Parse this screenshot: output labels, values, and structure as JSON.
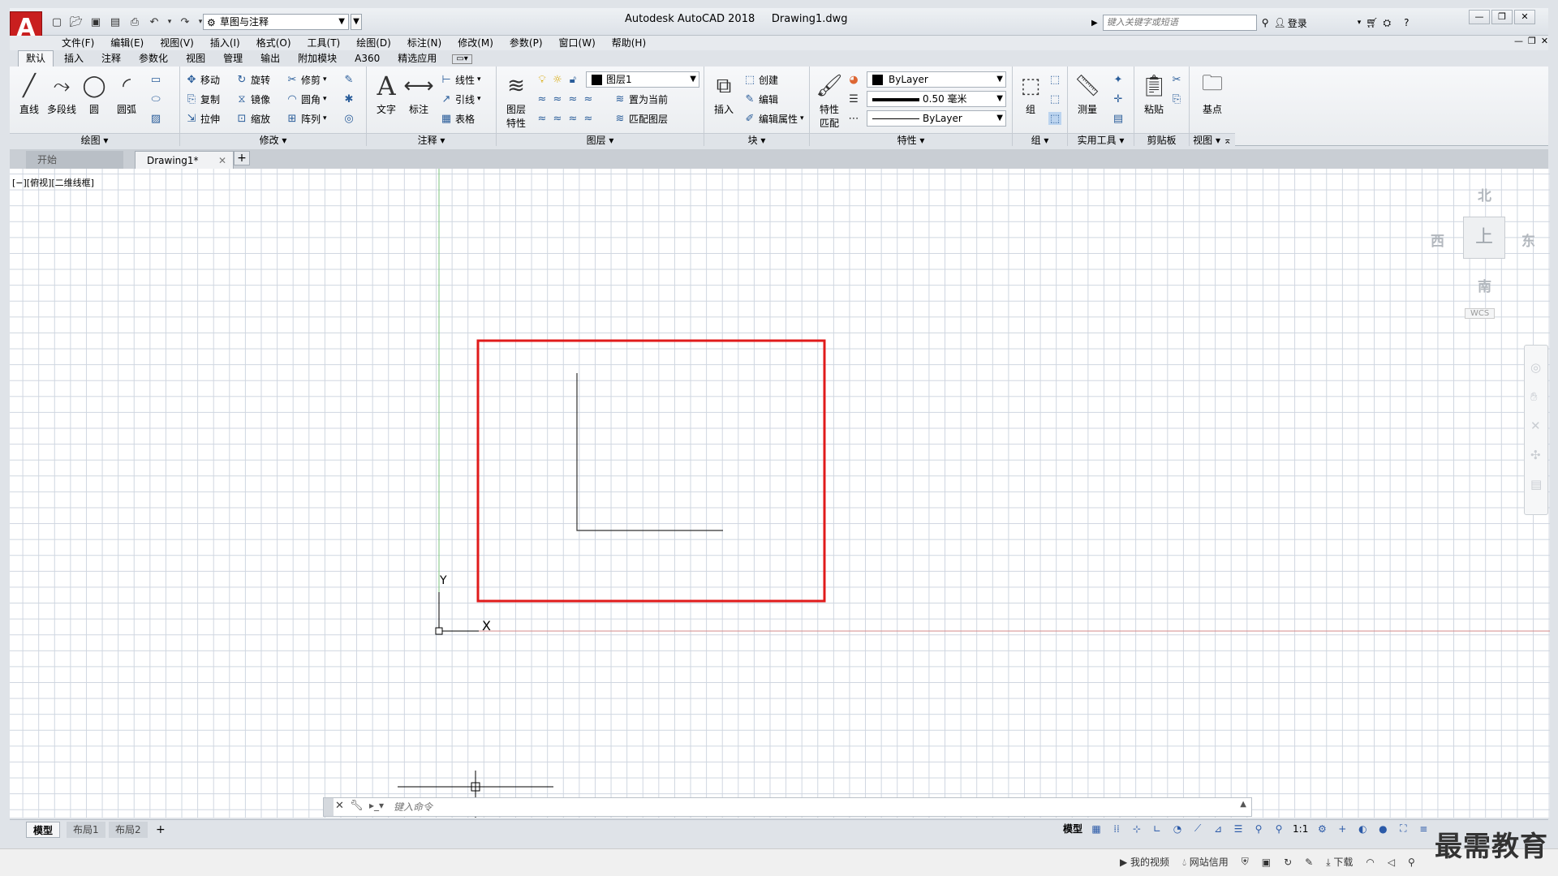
{
  "app": {
    "logo_letter": "A",
    "title": "Autodesk AutoCAD 2018",
    "document": "Drawing1.dwg",
    "workspace": "草图与注释"
  },
  "search": {
    "placeholder": "键入关键字或短语"
  },
  "account": {
    "login_label": "登录"
  },
  "menu": [
    "文件(F)",
    "编辑(E)",
    "视图(V)",
    "插入(I)",
    "格式(O)",
    "工具(T)",
    "绘图(D)",
    "标注(N)",
    "修改(M)",
    "参数(P)",
    "窗口(W)",
    "帮助(H)"
  ],
  "ribbon_tabs": [
    "默认",
    "插入",
    "注释",
    "参数化",
    "视图",
    "管理",
    "输出",
    "附加模块",
    "A360",
    "精选应用"
  ],
  "ribbon": {
    "draw": {
      "title": "绘图",
      "line": "直线",
      "polyline": "多段线",
      "circle": "圆",
      "arc": "圆弧"
    },
    "modify": {
      "title": "修改",
      "move": "移动",
      "rotate": "旋转",
      "trim": "修剪",
      "copy": "复制",
      "mirror": "镜像",
      "fillet": "圆角",
      "stretch": "拉伸",
      "scale": "缩放",
      "array": "阵列"
    },
    "annotation": {
      "title": "注释",
      "text": "文字",
      "dimension": "标注",
      "linear": "线性",
      "leader": "引线",
      "table": "表格"
    },
    "layers": {
      "title": "图层",
      "properties": "图层",
      "properties2": "特性",
      "current_layer": "图层1",
      "set_current": "置为当前",
      "match_layer": "匹配图层"
    },
    "block": {
      "title": "块",
      "insert": "插入",
      "create": "创建",
      "edit": "编辑",
      "edit_attr": "编辑属性"
    },
    "properties": {
      "title": "特性",
      "match": "特性",
      "match2": "匹配",
      "color": "ByLayer",
      "lineweight": "0.50 毫米",
      "linetype": "ByLayer"
    },
    "groups": {
      "title": "组",
      "group": "组"
    },
    "utilities": {
      "title": "实用工具",
      "measure": "测量"
    },
    "clipboard": {
      "title": "剪贴板",
      "paste": "粘贴"
    },
    "view": {
      "title": "视图",
      "base": "基点"
    }
  },
  "doc_tabs": {
    "start": "开始",
    "drawing": "Drawing1*"
  },
  "viewport_label": "[−][俯视][二维线框]",
  "viewcube": {
    "north": "北",
    "south": "南",
    "east": "东",
    "west": "西",
    "face": "上",
    "wcs": "WCS"
  },
  "ucs": {
    "x_label": "X",
    "y_label": "Y"
  },
  "command": {
    "placeholder": "键入命令"
  },
  "layout_tabs": [
    "模型",
    "布局1",
    "布局2"
  ],
  "status": {
    "model": "模型",
    "scale": "1:1"
  },
  "tray": {
    "video": "我的视频",
    "credit": "网站信用",
    "download": "下载"
  },
  "watermark": "最需教育",
  "colors": {
    "highlight_box": "#e01b1b",
    "grid": "#cfd6e0",
    "y_axis": "#7cc47c",
    "x_axis": "#d68a8a"
  }
}
